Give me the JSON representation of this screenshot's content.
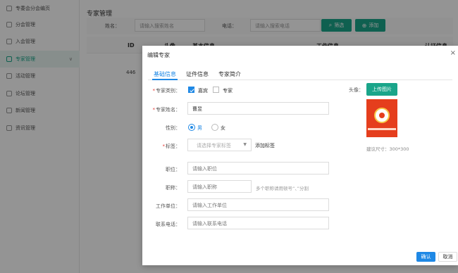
{
  "sidebar": {
    "items": [
      {
        "label": "专委会分会编页"
      },
      {
        "label": "分会管理"
      },
      {
        "label": "入会管理"
      },
      {
        "label": "专家管理"
      },
      {
        "label": "活动管理"
      },
      {
        "label": "论坛管理"
      },
      {
        "label": "新闻管理"
      },
      {
        "label": "资讯管理"
      }
    ]
  },
  "page": {
    "title": "专家管理",
    "filter": {
      "name_label": "姓名：",
      "name_placeholder": "请输入搜索姓名",
      "phone_label": "电话：",
      "phone_placeholder": "请输入搜索电话",
      "search_button": "筛选",
      "add_button": "添加"
    },
    "table": {
      "headers": [
        "ID",
        "头像",
        "基本信息",
        "工作信息",
        "认证信息"
      ],
      "rows": [
        {
          "id": "446"
        }
      ]
    }
  },
  "modal": {
    "title": "编辑专家",
    "close": "×",
    "tabs": [
      "基础信息",
      "证件信息",
      "专家简介"
    ],
    "form": {
      "category": {
        "label": "专家类别：",
        "options": [
          "嘉宾",
          "专家"
        ],
        "checked": [
          true,
          false
        ]
      },
      "name": {
        "label": "专家姓名：",
        "value": "曹昱"
      },
      "gender": {
        "label": "性别：",
        "options": [
          "男",
          "女"
        ],
        "selected": "男"
      },
      "tag": {
        "label": "标签：",
        "placeholder": "请选择专家标签",
        "add_link": "添加标签"
      },
      "position": {
        "label": "职位：",
        "placeholder": "请输入职位"
      },
      "title": {
        "label": "职称：",
        "placeholder": "请输入职称",
        "hint": "多个职称请用顿号“、”分割"
      },
      "workplace": {
        "label": "工作单位：",
        "placeholder": "请输入工作单位"
      },
      "phone": {
        "label": "联系电话：",
        "placeholder": "请输入联系电话"
      }
    },
    "avatar": {
      "label": "头像：",
      "upload_button": "上传图片",
      "size_hint": "建议尺寸：300*300"
    },
    "footer": {
      "confirm": "确认",
      "cancel": "取消"
    }
  },
  "colors": {
    "teal": "#1aa58a",
    "primary": "#1e88e5",
    "required": "#e53935",
    "avatar_bg": "#e53e1d"
  }
}
